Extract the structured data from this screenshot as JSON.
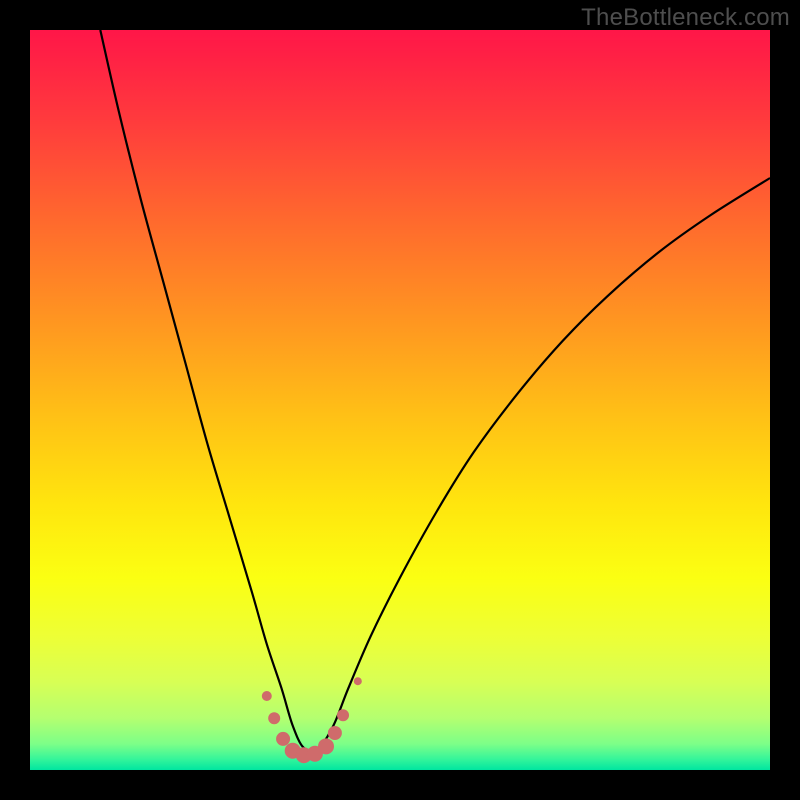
{
  "watermark": {
    "text": "TheBottleneck.com"
  },
  "palette": {
    "black": "#000000",
    "curve": "#000000",
    "bubble_fill": "#cf6b6b",
    "bubble_stroke": "#c05a5a",
    "gradient_stops": [
      {
        "offset": 0.0,
        "color": "#ff1648"
      },
      {
        "offset": 0.12,
        "color": "#ff3a3d"
      },
      {
        "offset": 0.26,
        "color": "#ff6a2d"
      },
      {
        "offset": 0.4,
        "color": "#ff9820"
      },
      {
        "offset": 0.52,
        "color": "#ffc016"
      },
      {
        "offset": 0.64,
        "color": "#ffe50e"
      },
      {
        "offset": 0.74,
        "color": "#fbff12"
      },
      {
        "offset": 0.82,
        "color": "#edff36"
      },
      {
        "offset": 0.88,
        "color": "#d8ff54"
      },
      {
        "offset": 0.93,
        "color": "#b4ff70"
      },
      {
        "offset": 0.965,
        "color": "#7cff88"
      },
      {
        "offset": 0.985,
        "color": "#36f59a"
      },
      {
        "offset": 1.0,
        "color": "#00e6a0"
      }
    ]
  },
  "chart_data": {
    "type": "line",
    "title": "",
    "xlabel": "",
    "ylabel": "",
    "xlim": [
      0,
      100
    ],
    "ylim": [
      0,
      100
    ],
    "note": "x and y are percentage coordinates within the plot area; y=0 is the bottom edge. Curve descends from top-left to a bottom vertex near x≈37 then rises toward upper-right.",
    "series": [
      {
        "name": "curve",
        "x": [
          9.5,
          12,
          15,
          18,
          21,
          24,
          27,
          30,
          32,
          34,
          35.5,
          37,
          39,
          41,
          43,
          46,
          50,
          55,
          60,
          66,
          72,
          78,
          85,
          92,
          100
        ],
        "y": [
          100,
          89,
          77,
          66,
          55,
          44,
          34,
          24,
          17,
          11,
          6,
          3,
          3,
          6,
          11,
          18,
          26,
          35,
          43,
          51,
          58,
          64,
          70,
          75,
          80
        ]
      }
    ],
    "bubbles": {
      "name": "highlight-points",
      "color": "#cf6b6b",
      "points": [
        {
          "x": 32.0,
          "y": 10.0,
          "r": 5
        },
        {
          "x": 33.0,
          "y": 7.0,
          "r": 6
        },
        {
          "x": 34.2,
          "y": 4.2,
          "r": 7
        },
        {
          "x": 35.5,
          "y": 2.6,
          "r": 8
        },
        {
          "x": 37.0,
          "y": 2.0,
          "r": 8
        },
        {
          "x": 38.5,
          "y": 2.2,
          "r": 8
        },
        {
          "x": 40.0,
          "y": 3.2,
          "r": 8
        },
        {
          "x": 41.2,
          "y": 5.0,
          "r": 7
        },
        {
          "x": 42.3,
          "y": 7.4,
          "r": 6
        },
        {
          "x": 44.3,
          "y": 12.0,
          "r": 4
        }
      ]
    }
  }
}
